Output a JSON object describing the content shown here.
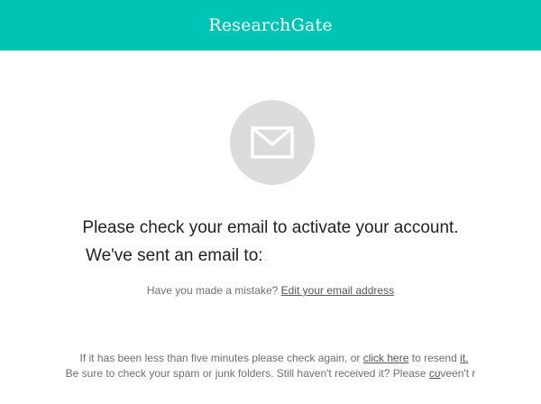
{
  "header": {
    "brand": "ResearchGate"
  },
  "icon": {
    "name": "envelope-icon"
  },
  "message": {
    "headline": "Please check your email to activate your account.",
    "sent_to": "We've sent an email to:",
    "sent_to_suffix": "..",
    "mistake_prefix": "Have you made a mistake?",
    "edit_email_link": "Edit your email address"
  },
  "footer": {
    "line1_prefix": "If it has been less than five minutes please check again, or",
    "click_here_link": "click here",
    "line1_middle": "to resend",
    "line1_it_link": "it.",
    "line2_prefix": "Be sure to check your spam or junk folders. Still haven't received it? Please",
    "line2_link": "cᴜ",
    "line2_suffix": "veen't r"
  },
  "colors": {
    "header_bg": "#00c4b3",
    "icon_circle": "#dcdcdc",
    "text_dark": "#222222",
    "text_muted": "#707070"
  }
}
